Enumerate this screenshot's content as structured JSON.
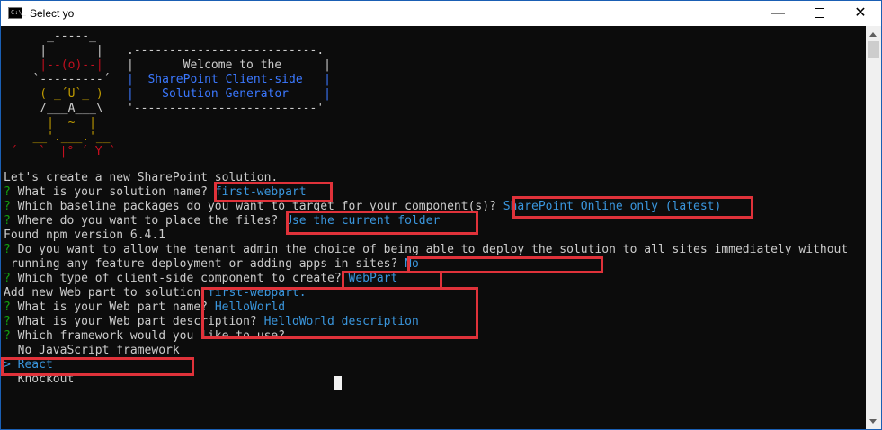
{
  "window": {
    "title": "Select yo",
    "icon_text": "C:\\_"
  },
  "banner": {
    "art": [
      "     _-----_",
      "    |       |",
      "    |--(o)--|",
      "   `---------´",
      "    ( _´U`_ )",
      "    /___A___\\",
      "     |  ~  |",
      "   __'.___.'__",
      " ´   `  |° ´ Y `"
    ],
    "box": [
      ".--------------------------.",
      "|       Welcome to the      |",
      "|  SharePoint Client-side   |",
      "|    Solution Generator     |",
      "'--------------------------'"
    ]
  },
  "lines": {
    "l1": "Let's create a new SharePoint solution.",
    "q1": "What is your solution name?",
    "a1": "first-webpart",
    "q2": "Which baseline packages do you want to target for your component(s)?",
    "a2": "SharePoint Online only (latest)",
    "q3": "Where do you want to place the files?",
    "a3": "Use the current folder",
    "l5": "Found npm version 6.4.1",
    "q4a": "Do you want to allow the tenant admin the choice of being able to deploy the solution to all sites immediately without",
    "q4b": "running any feature deployment or adding apps in sites?",
    "a4": "No",
    "q5": "Which type of client-side component to create?",
    "a5": "WebPart",
    "l9": "Add new Web part to solution",
    "l9v": "first-webpart.",
    "q6": "What is your Web part name?",
    "a6": "HelloWorld",
    "q7": "What is your Web part description?",
    "a7": "HelloWorld description",
    "q8": "Which framework would you like to use?",
    "opt1": "No JavaScript framework",
    "opt2": "React",
    "opt3": "Knockout",
    "qmark": "?",
    "pointer": ">"
  },
  "colors": {
    "highlight": "#e0323a",
    "answer": "#3a96dd",
    "prompt": "#13a10e"
  }
}
